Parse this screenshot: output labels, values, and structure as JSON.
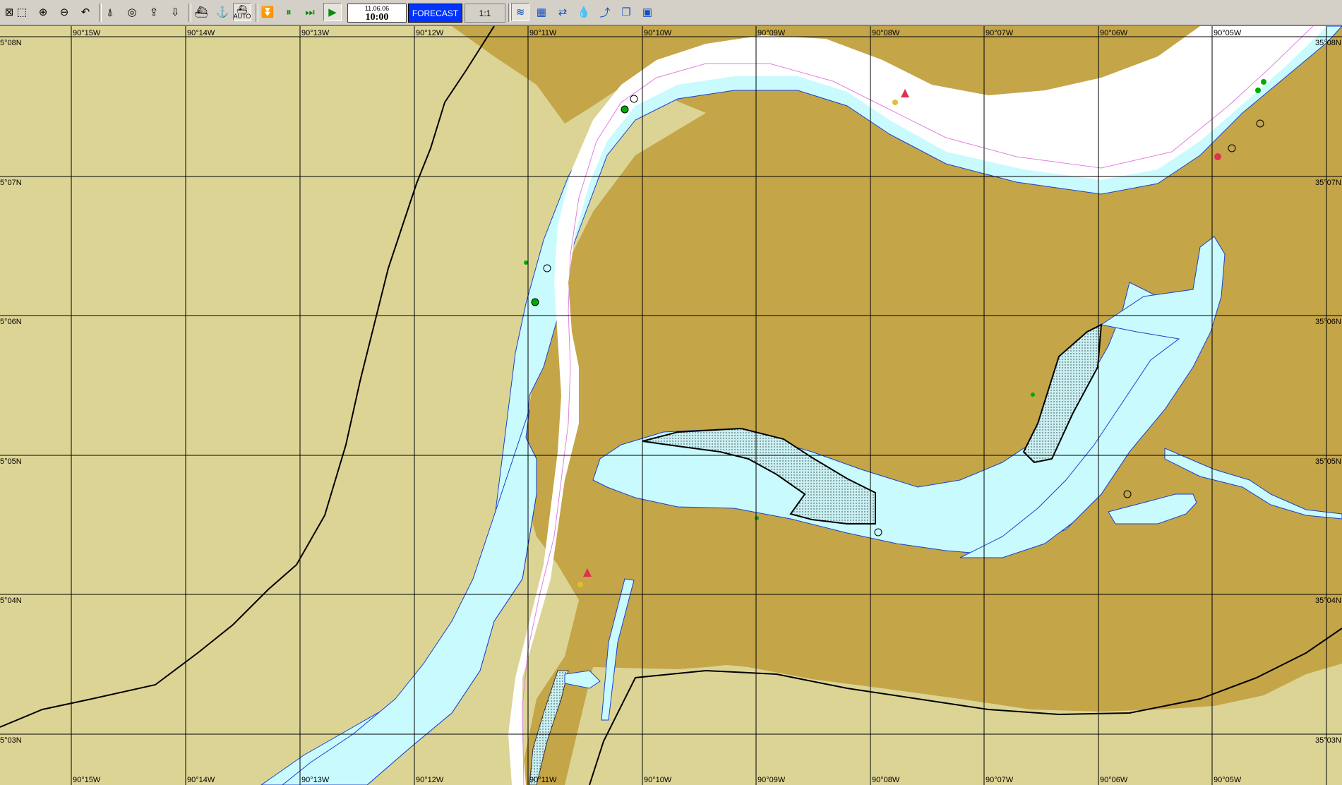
{
  "toolbar": {
    "date": "11.06.06",
    "time": "10:00",
    "forecast_label": "FORECAST",
    "scale": "1:1",
    "auto_label": "AUTO",
    "icons": [
      "close-icon",
      "zoom-box-icon",
      "zoom-in-icon",
      "zoom-out-icon",
      "undo-icon",
      "north-arrow-icon",
      "target-icon",
      "export-icon",
      "import-icon",
      "ship-icon",
      "tug-icon",
      "auto-icon",
      "step-down-icon",
      "pause-icon",
      "fast-forward-icon",
      "play-icon",
      "layers-icon",
      "chart-icon",
      "route-icon",
      "depth-icon",
      "track-icon",
      "copy-icon",
      "window-icon"
    ]
  },
  "map": {
    "colors": {
      "land": "#dcd495",
      "urban": "#c4a548",
      "water": "#c8fafe",
      "channel": "#ffffff",
      "grid": "#000000"
    },
    "lon_labels": [
      "90°15W",
      "90°14W",
      "90°13W",
      "90°12W",
      "90°11W",
      "90°10W",
      "90°09W",
      "90°08W",
      "90°07W",
      "90°06W",
      "90°05W"
    ],
    "lat_labels_left": [
      "5°08N",
      "5°07N",
      "5°06N",
      "5°05N",
      "5°04N",
      "5°03N"
    ],
    "lat_labels_right": [
      "35°08N",
      "35°07N",
      "35°06N",
      "35°05N",
      "35°04N",
      "35°03N"
    ]
  }
}
